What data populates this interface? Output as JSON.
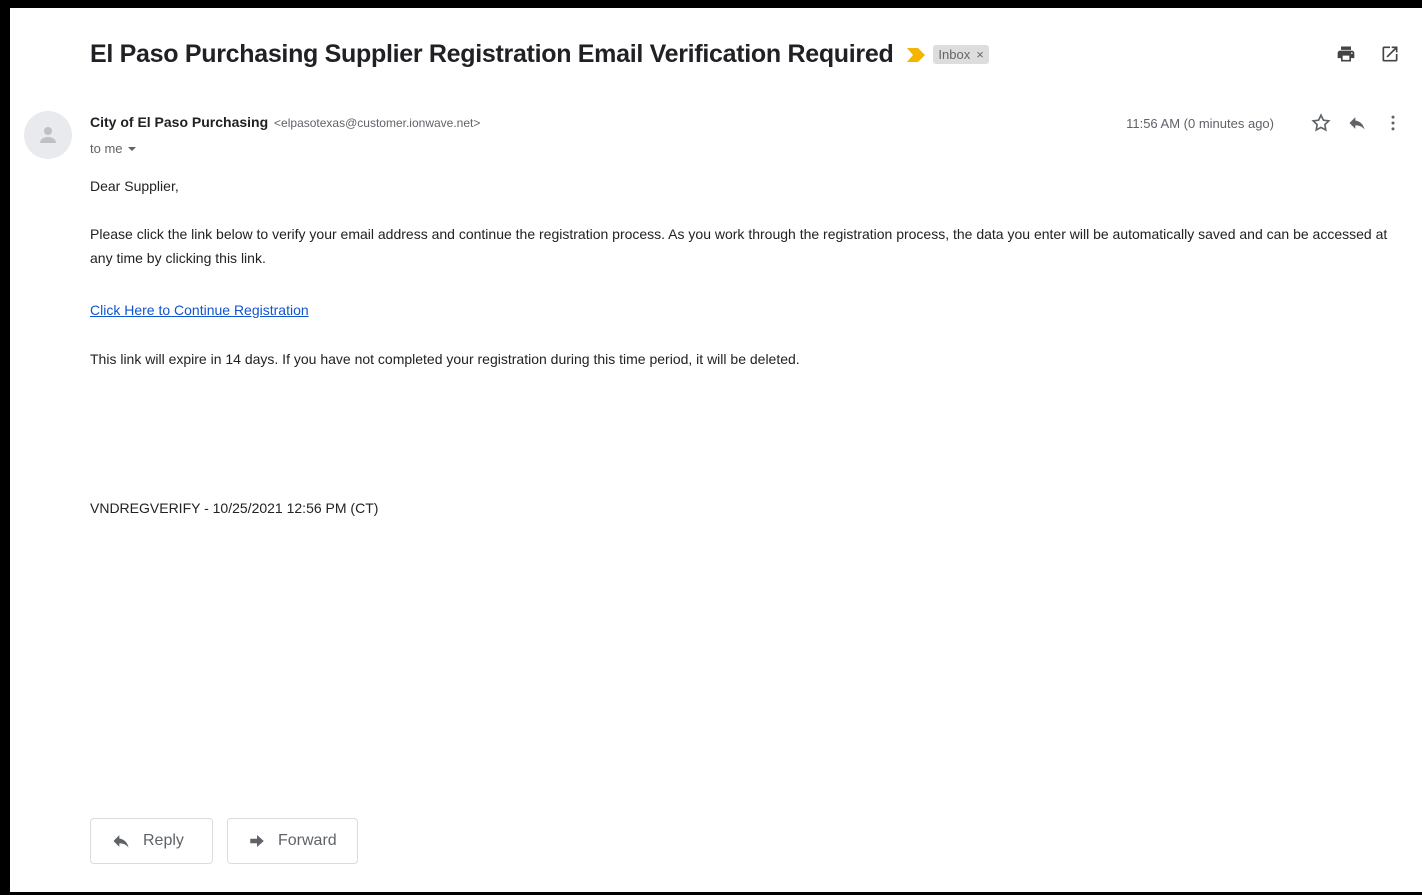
{
  "email": {
    "subject": "El Paso Purchasing Supplier Registration Email Verification Required",
    "label": "Inbox",
    "label_close": "×",
    "sender_name": "City of El Paso Purchasing",
    "sender_email": "<elpasotexas@customer.ionwave.net>",
    "to_me": "to me",
    "timestamp": "11:56 AM (0 minutes ago)",
    "greeting": "Dear Supplier,",
    "paragraph_1": "Please click the link below to verify your email address and continue the registration process. As you work through the registration process, the data you enter will be automatically saved and can be accessed at any time by clicking this link.",
    "link_text": "Click Here to Continue Registration",
    "paragraph_2": "This link will expire in 14 days. If you have not completed your registration during this time period, it will be deleted.",
    "footer_code": "VNDREGVERIFY - 10/25/2021 12:56 PM (CT)"
  },
  "actions": {
    "reply_label": "Reply",
    "forward_label": "Forward"
  },
  "icons": {
    "importance": "importance-marker-icon",
    "print": "print-icon",
    "open_new_window": "open-in-new-window-icon",
    "avatar": "person-avatar-icon",
    "star": "star-icon",
    "reply": "reply-icon",
    "more": "more-vertical-icon",
    "dropdown": "chevron-down-icon",
    "forward": "forward-icon"
  },
  "colors": {
    "link": "#1155cc",
    "importance": "#f4b400",
    "label_bg": "#dddddd"
  }
}
